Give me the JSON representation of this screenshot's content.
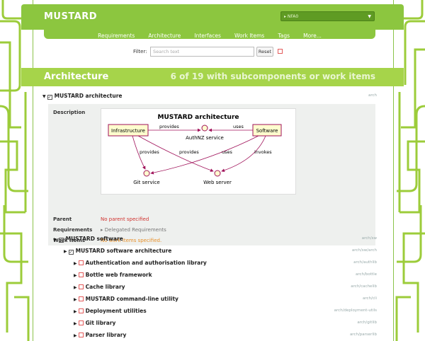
{
  "header": {
    "brand": "MUSTARD",
    "project_select": "NFA0",
    "nav": [
      "Requirements",
      "Architecture",
      "Interfaces",
      "Work Items",
      "Tags",
      "More..."
    ]
  },
  "filter": {
    "label": "Filter:",
    "placeholder": "Search text",
    "reset_label": "Reset"
  },
  "section": {
    "title": "Architecture",
    "count": "6 of 19 with subcomponents or work items"
  },
  "root": {
    "name": "MUSTARD architecture",
    "path": "arch",
    "description_label": "Description",
    "diagram": {
      "title": "MUSTARD architecture",
      "nodes": [
        "Infrastructure",
        "AuthNZ service",
        "Software",
        "Git service",
        "Web server"
      ],
      "edges": [
        "provides",
        "uses",
        "provides",
        "provides",
        "uses",
        "invokes"
      ]
    },
    "parent_label": "Parent",
    "parent_value": "No parent specified",
    "requirements_label": "Requirements",
    "requirements_value": "Delegated Requirements",
    "work_items_label": "Work Items",
    "work_items_value": "No work items specified."
  },
  "tree": [
    {
      "name": "MUSTARD software",
      "path": "arch/sw"
    },
    {
      "name": "MUSTARD software architecture",
      "path": "arch/sw/arch"
    },
    {
      "name": "Authentication and authorisation library",
      "path": "arch/authlib"
    },
    {
      "name": "Bottle web framework",
      "path": "arch/bottle"
    },
    {
      "name": "Cache library",
      "path": "arch/cachelib"
    },
    {
      "name": "MUSTARD command-line utility",
      "path": "arch/cli"
    },
    {
      "name": "Deployment utilities",
      "path": "arch/deployment-utils"
    },
    {
      "name": "Git library",
      "path": "arch/gitlib"
    },
    {
      "name": "Parser library",
      "path": "arch/parserlib"
    }
  ],
  "colors": {
    "accent": "#8cc63f",
    "header": "#a6d44a",
    "error": "#d0312d",
    "warning": "#e8902a"
  }
}
